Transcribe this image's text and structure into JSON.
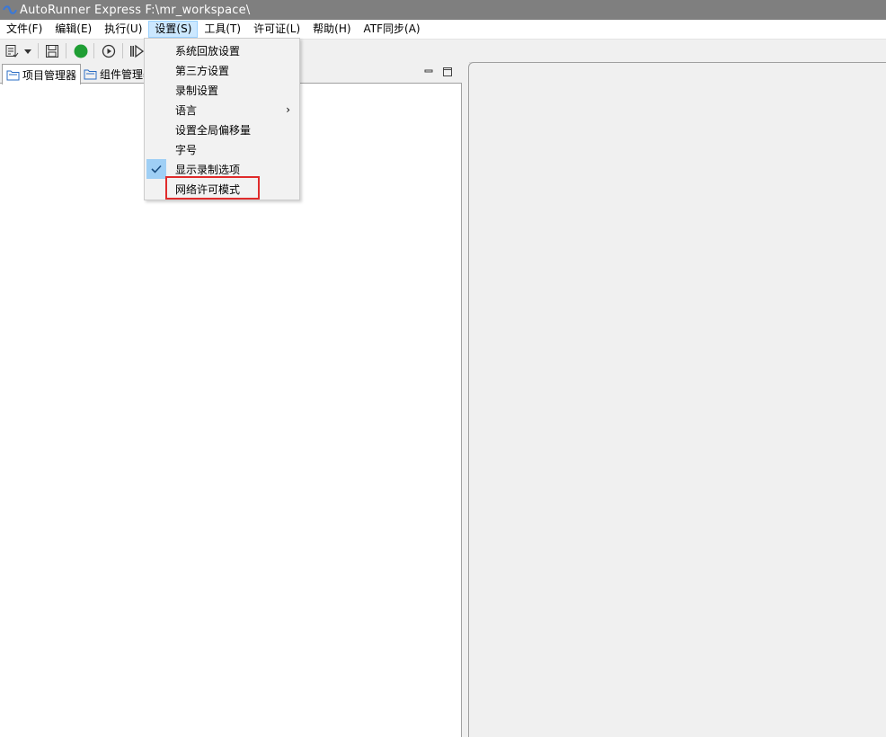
{
  "window": {
    "title": "AutoRunner Express  F:\\mr_workspace\\"
  },
  "menubar": {
    "items": [
      "文件(F)",
      "编辑(E)",
      "执行(U)",
      "设置(S)",
      "工具(T)",
      "许可证(L)",
      "帮助(H)",
      "ATF同步(A)"
    ],
    "active_index": 3
  },
  "panel": {
    "tabs": [
      "项目管理器",
      "组件管理器"
    ]
  },
  "settings_menu": {
    "items": [
      {
        "label": "系统回放设置"
      },
      {
        "label": "第三方设置"
      },
      {
        "label": "录制设置"
      },
      {
        "label": "语言",
        "submenu": true
      },
      {
        "label": "设置全局偏移量"
      },
      {
        "label": "字号"
      },
      {
        "label": "显示录制选项",
        "checked": true
      },
      {
        "label": "网络许可模式",
        "highlighted": true
      }
    ]
  },
  "colors": {
    "accent_check": "#9fcff5",
    "highlight_box": "#e02b2b",
    "record_button": "#1f9e34"
  }
}
